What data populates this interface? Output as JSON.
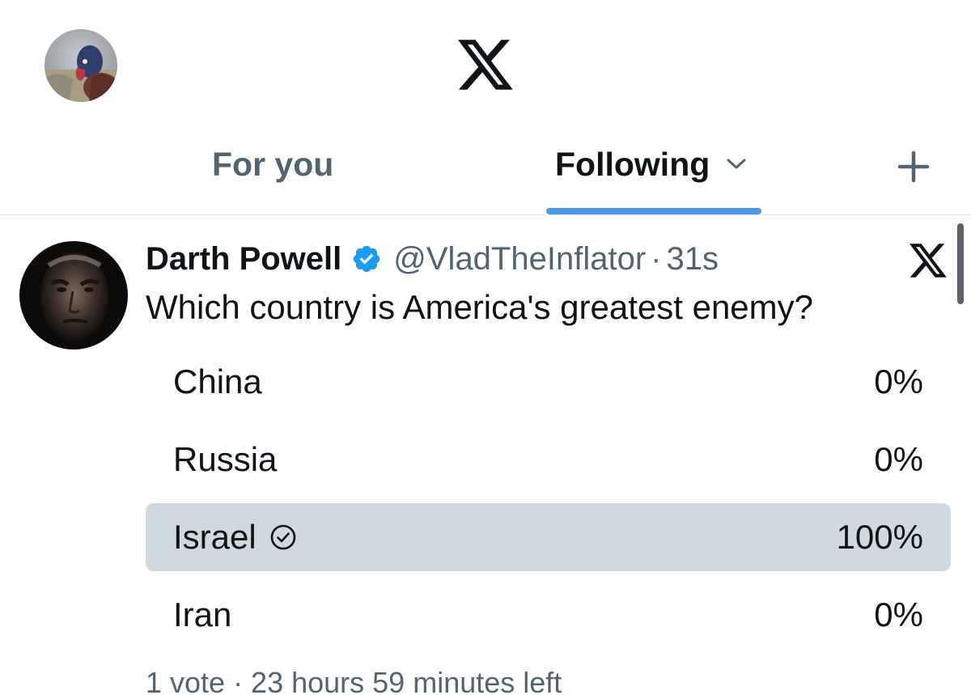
{
  "top_bar": {
    "avatar_icon": "user-avatar-photo",
    "logo_icon": "x-logo-icon"
  },
  "tabs": {
    "for_you_label": "For you",
    "following_label": "Following",
    "following_dropdown_icon": "chevron-down-icon",
    "active_tab": "Following",
    "indicator_color": "#4a99e9",
    "add_icon": "plus-icon"
  },
  "post": {
    "author_name": "Darth Powell",
    "verified_icon": "verified-badge-icon",
    "verified_color": "#1d9bf0",
    "handle": "@VladTheInflator",
    "separator": "·",
    "timestamp": "31s",
    "menu_icon": "x-logo-icon",
    "text": "Which country is America's greatest enemy?"
  },
  "poll": {
    "options": [
      {
        "label": "China",
        "percent": "0%",
        "fraction": 0,
        "selected": false
      },
      {
        "label": "Russia",
        "percent": "0%",
        "fraction": 0,
        "selected": false
      },
      {
        "label": "Israel",
        "percent": "100%",
        "fraction": 1,
        "selected": true
      },
      {
        "label": "Iran",
        "percent": "0%",
        "fraction": 0,
        "selected": false
      }
    ],
    "selected_icon": "check-circle-icon",
    "bar_color": "#cfd9de",
    "meta": "1 vote · 23 hours 59 minutes left"
  }
}
